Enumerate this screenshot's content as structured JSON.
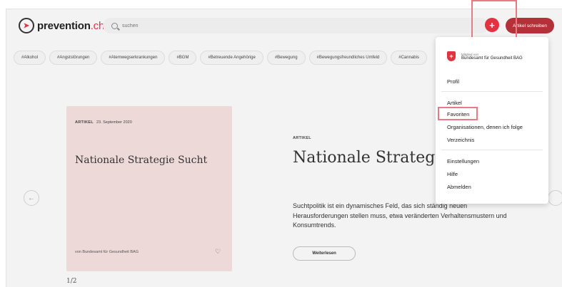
{
  "header": {
    "logo_main": "prevention",
    "logo_tld": ".ch",
    "search_placeholder": "suchen",
    "write_button": "Artikel schreiben"
  },
  "tags": [
    "#Alkohol",
    "#Angststörungen",
    "#Atemwegserkrankungen",
    "#BGM",
    "#Betreuende Angehörige",
    "#Bewegung",
    "#Bewegungsfreundliches Umfeld",
    "#Cannabis"
  ],
  "card": {
    "type": "ARTIKEL",
    "date": "23. September 2020",
    "title": "Nationale Strategie Sucht",
    "source": "von Bundesamt für Gesundheit BAG"
  },
  "pager": "1/2",
  "article": {
    "label": "ARTIKEL",
    "title": "Nationale Strategie Sucht",
    "description": "Suchtpolitik ist ein dynamisches Feld, das sich ständig neuen Herausforderungen stellen muss, etwa veränderten Verhaltensmustern und Konsumtrends.",
    "read_button": "Weiterlesen"
  },
  "menu": {
    "member_small": "Mitglied von",
    "member_name": "Bundesamt für Gesundheit BAG",
    "profile": "Profil",
    "articles": "Artikel",
    "favorites": "Favoriten",
    "following": "Organisationen, denen ich folge",
    "directory": "Verzeichnis",
    "settings": "Einstellungen",
    "help": "Hilfe",
    "logout": "Abmelden"
  },
  "colors": {
    "brand_red": "#e0333f",
    "button_red": "#b5313a",
    "card_pink": "#eed9d9",
    "highlight": "#e87a82"
  }
}
